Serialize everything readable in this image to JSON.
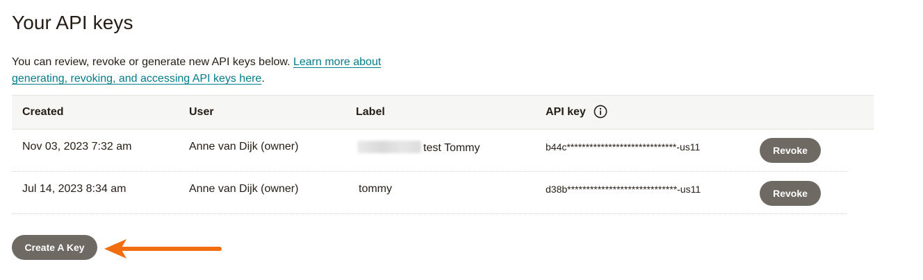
{
  "page": {
    "title": "Your API keys",
    "intro_text": "You can review, revoke or generate new API keys below. ",
    "intro_link": "Learn more about generating, revoking, and accessing API keys here",
    "intro_end": "."
  },
  "table": {
    "headers": {
      "created": "Created",
      "user": "User",
      "label": "Label",
      "api_key": "API key"
    },
    "rows": [
      {
        "created": "Nov 03, 2023 7:32 am",
        "user": "Anne van Dijk (owner)",
        "label": "test Tommy",
        "label_redacted": true,
        "api_key": "b44c*****************************-us11",
        "action": "Revoke"
      },
      {
        "created": "Jul 14, 2023 8:34 am",
        "user": "Anne van Dijk (owner)",
        "label": "tommy",
        "label_redacted": false,
        "api_key": "d38b*****************************-us11",
        "action": "Revoke"
      }
    ]
  },
  "actions": {
    "create_key": "Create A Key"
  },
  "icons": {
    "info": "info-icon",
    "annotation": "arrow-annotation-icon"
  },
  "colors": {
    "link": "#007c89",
    "button_bg": "#6f6964",
    "header_bg": "#f6f6f4",
    "annotation_arrow": "#f26d0f"
  }
}
